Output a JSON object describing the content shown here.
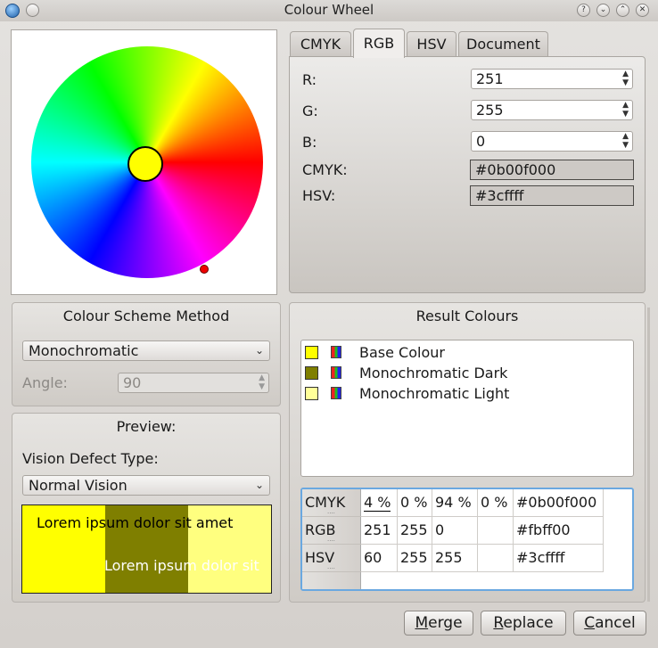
{
  "window": {
    "title": "Colour Wheel"
  },
  "wheel": {
    "selected_color": "#ffff00"
  },
  "tabs": [
    {
      "label": "CMYK",
      "active": false
    },
    {
      "label": "RGB",
      "active": true
    },
    {
      "label": "HSV",
      "active": false
    },
    {
      "label": "Document",
      "active": false
    }
  ],
  "rgb_tab": {
    "r_label": "R:",
    "r_value": "251",
    "g_label": "G:",
    "g_value": "255",
    "b_label": "B:",
    "b_value": "0",
    "cmyk_label": "CMYK:",
    "cmyk_value": "#0b00f000",
    "hsv_label": "HSV:",
    "hsv_value": "#3cffff"
  },
  "scheme": {
    "heading": "Colour Scheme Method",
    "method": "Monochromatic",
    "angle_label": "Angle:",
    "angle_value": "90"
  },
  "preview": {
    "heading": "Preview:",
    "defect_label": "Vision Defect Type:",
    "defect_value": "Normal Vision",
    "sample_text_1": "Lorem ipsum dolor sit amet",
    "sample_text_2": "Lorem ipsum dolor sit",
    "colors": [
      "#ffff00",
      "#7f7f00",
      "#ffff7f"
    ]
  },
  "results": {
    "heading": "Result Colours",
    "items": [
      {
        "label": "Base Colour",
        "color": "#ffff00"
      },
      {
        "label": "Monochromatic Dark",
        "color": "#7f7f00"
      },
      {
        "label": "Monochromatic Light",
        "color": "#ffff99"
      }
    ]
  },
  "table": {
    "rows": [
      {
        "header": "CMYK",
        "cells": [
          "4 %",
          "0 %",
          "94 %",
          "0 %",
          "#0b00f000"
        ]
      },
      {
        "header": "RGB",
        "cells": [
          "251",
          "255",
          "0",
          "",
          "#fbff00"
        ]
      },
      {
        "header": "HSV",
        "cells": [
          "60",
          "255",
          "255",
          "",
          "#3cffff"
        ]
      }
    ]
  },
  "buttons": {
    "merge": {
      "mnemonic": "M",
      "rest": "erge"
    },
    "replace": {
      "mnemonic": "R",
      "rest": "eplace"
    },
    "cancel": {
      "mnemonic": "C",
      "rest": "ancel"
    }
  }
}
